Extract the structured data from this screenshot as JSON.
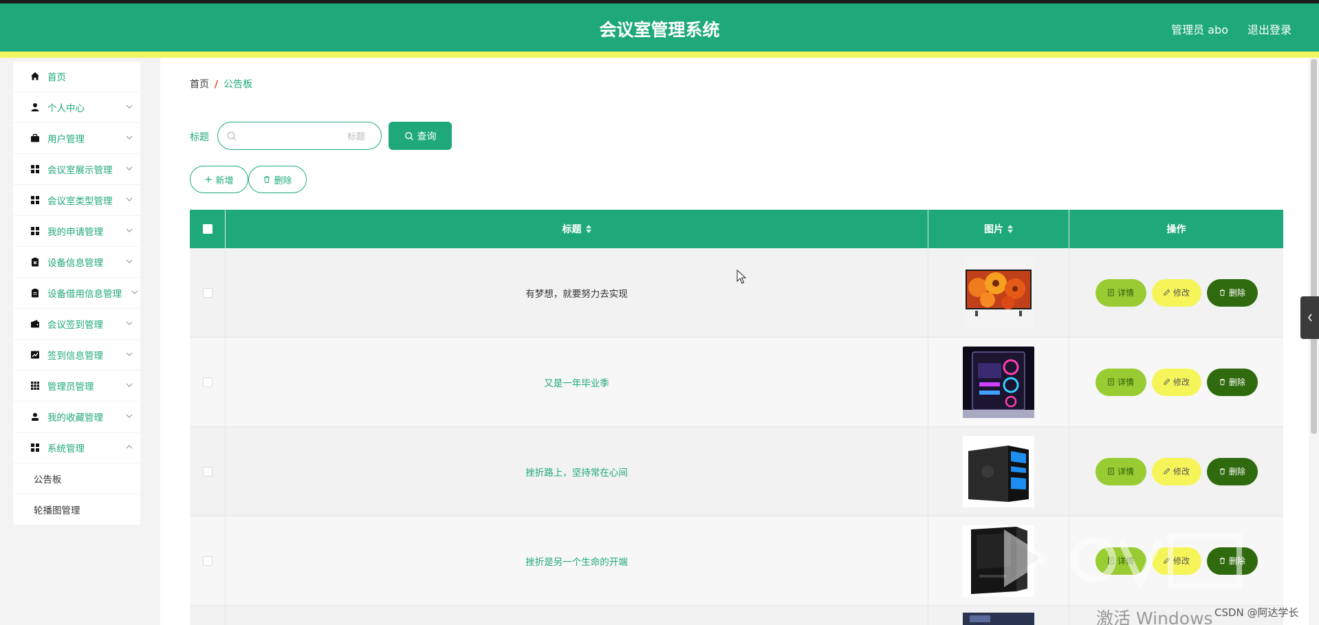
{
  "header": {
    "title": "会议室管理系统",
    "user": "管理员 abo",
    "logout": "退出登录"
  },
  "sidebar": {
    "items": [
      {
        "label": "首页",
        "icon": "home-icon"
      },
      {
        "label": "个人中心",
        "icon": "user-icon"
      },
      {
        "label": "用户管理",
        "icon": "briefcase-icon"
      },
      {
        "label": "会议室展示管理",
        "icon": "grid-icon"
      },
      {
        "label": "会议室类型管理",
        "icon": "grid-icon"
      },
      {
        "label": "我的申请管理",
        "icon": "grid-icon"
      },
      {
        "label": "设备信息管理",
        "icon": "clipboard-x-icon"
      },
      {
        "label": "设备借用信息管理",
        "icon": "clipboard-icon"
      },
      {
        "label": "会议签到管理",
        "icon": "wallet-icon"
      },
      {
        "label": "签到信息管理",
        "icon": "chart-icon"
      },
      {
        "label": "管理员管理",
        "icon": "apps-icon"
      },
      {
        "label": "我的收藏管理",
        "icon": "person-icon"
      },
      {
        "label": "系统管理",
        "icon": "grid-icon"
      }
    ],
    "subitems": [
      {
        "label": "公告板"
      },
      {
        "label": "轮播图管理"
      }
    ]
  },
  "breadcrumb": {
    "home": "首页",
    "sep": "/",
    "current": "公告板"
  },
  "search": {
    "label": "标题",
    "placeholder": "标题",
    "value": "",
    "button": "查询"
  },
  "actions": {
    "add": "新增",
    "delete": "删除"
  },
  "table": {
    "headers": {
      "title": "标题",
      "image": "图片",
      "ops": "操作"
    },
    "rows": [
      {
        "title": "有梦想，就要努力去实现",
        "title_color": "#333333",
        "image": "tv-flower-image"
      },
      {
        "title": "又是一年毕业季",
        "title_color": "#1fa97a",
        "image": "gaming-pc-image"
      },
      {
        "title": "挫折路上，坚持常在心间",
        "title_color": "#1fa97a",
        "image": "pc-tower-blue-image"
      },
      {
        "title": "挫折是另一个生命的开端",
        "title_color": "#1fa97a",
        "image": "pc-tower-black-image"
      }
    ],
    "op_labels": {
      "detail": "详情",
      "edit": "修改",
      "delete": "删除"
    }
  },
  "colors": {
    "primary": "#1fa97a",
    "yellow_bar": "#f3f75f",
    "detail_btn": "#99cc33",
    "edit_btn": "#f5f55a",
    "delete_btn": "#2f6a0e"
  },
  "watermark": {
    "activate": "激活 Windows",
    "csdn": "CSDN @阿达学长"
  }
}
